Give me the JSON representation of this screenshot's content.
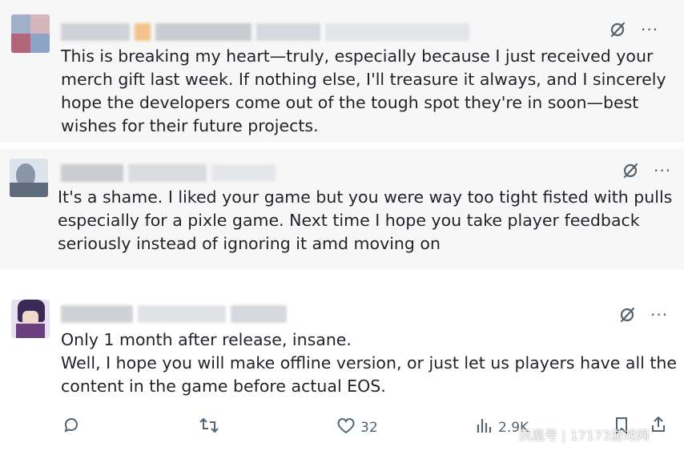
{
  "replies": [
    {
      "text": "This is breaking my heart—truly, especially because I just received your\nmerch gift last week. If nothing else, I'll treasure it always, and I sincerely\nhope the developers come out of the tough spot they're in soon—best\nwishes for their future projects."
    },
    {
      "text": "It's a shame. I liked your game but you were way too tight fisted with pulls\nespecially for a pixle game. Next time I hope you take player feedback\nseriously instead of ignoring it amd moving on"
    },
    {
      "text": "Only 1 month after release, insane.\nWell, I hope you will make offline version, or just let us players have all the\ncontent in the game before actual EOS."
    }
  ],
  "actions": {
    "likes": "32",
    "views": "2.9K"
  },
  "more_glyph": "···",
  "watermark": "凤凰号 | 17173游戏网",
  "icons": [
    "grok-icon",
    "more-icon",
    "reply-icon",
    "repost-icon",
    "like-icon",
    "views-icon",
    "bookmark-icon",
    "share-icon"
  ]
}
